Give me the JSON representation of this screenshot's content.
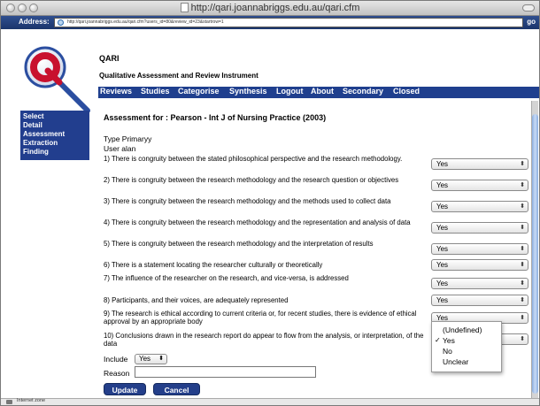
{
  "window": {
    "title": "http://qari.joannabriggs.edu.au/qari.cfm"
  },
  "address_bar": {
    "label": "Address:",
    "url": "http://qari.joannabriggs.edu.au/qari.cfm?users_id=80&review_id=23&startrow=1",
    "go": "go"
  },
  "header": {
    "app_name": "QARI",
    "subtitle": "Qualitative Assessment and Review Instrument"
  },
  "nav": [
    "Reviews",
    "Studies",
    "Categorise",
    "Synthesis",
    "Logout",
    "About",
    "Secondary",
    "Closed"
  ],
  "left_menu": [
    "Select",
    "Detail",
    "Assessment",
    "Extraction",
    "Finding"
  ],
  "assessment": {
    "heading": "Assessment for : Pearson - Int J of Nursing Practice (2003)",
    "type": "Type Primaryy",
    "user": "User alan"
  },
  "questions": [
    {
      "text": "1) There is congruity between the stated philosophical perspective and the research methodology.",
      "value": "Yes"
    },
    {
      "text": "2) There is congruity between the research methodology and the research question or objectives",
      "value": "Yes"
    },
    {
      "text": "3) There is congruity between the research methodology and the methods used to collect data",
      "value": "Yes"
    },
    {
      "text": "4) There is congruity between the research methodology and the representation and analysis of data",
      "value": "Yes"
    },
    {
      "text": "5) There is congruity between the research methodology and the interpretation of results",
      "value": "Yes"
    },
    {
      "text": "6) There is a statement locating the researcher culturally or theoretically",
      "value": "Yes"
    },
    {
      "text": "7) The influence of the researcher on the research, and vice-versa, is addressed",
      "value": "Yes"
    },
    {
      "text": "8) Participants, and their voices, are adequately represented",
      "value": "Yes"
    },
    {
      "text": "9) The research is ethical according to current criteria or, for recent studies, there is evidence of ethical approval by an appropriate body",
      "value": "Yes"
    },
    {
      "text": "10) Conclusions drawn in the research report do appear to flow from the analysis, or interpretation, of the data",
      "value": ""
    }
  ],
  "dropdown": {
    "options": [
      "(Undefined)",
      "Yes",
      "No",
      "Unclear"
    ],
    "selected": "Yes",
    "check": "✓"
  },
  "include": {
    "label": "Include",
    "value": "Yes"
  },
  "reason": {
    "label": "Reason",
    "value": ""
  },
  "buttons": {
    "update": "Update",
    "cancel": "Cancel"
  },
  "status_bar": {
    "text": "Internet zone"
  },
  "icons": {
    "select_arrow": "⬍"
  },
  "colors": {
    "nav_bg": "#1f3f8e",
    "button_bg": "#243f8a",
    "logo_red": "#c8102e",
    "logo_blue": "#2b4ea0"
  }
}
